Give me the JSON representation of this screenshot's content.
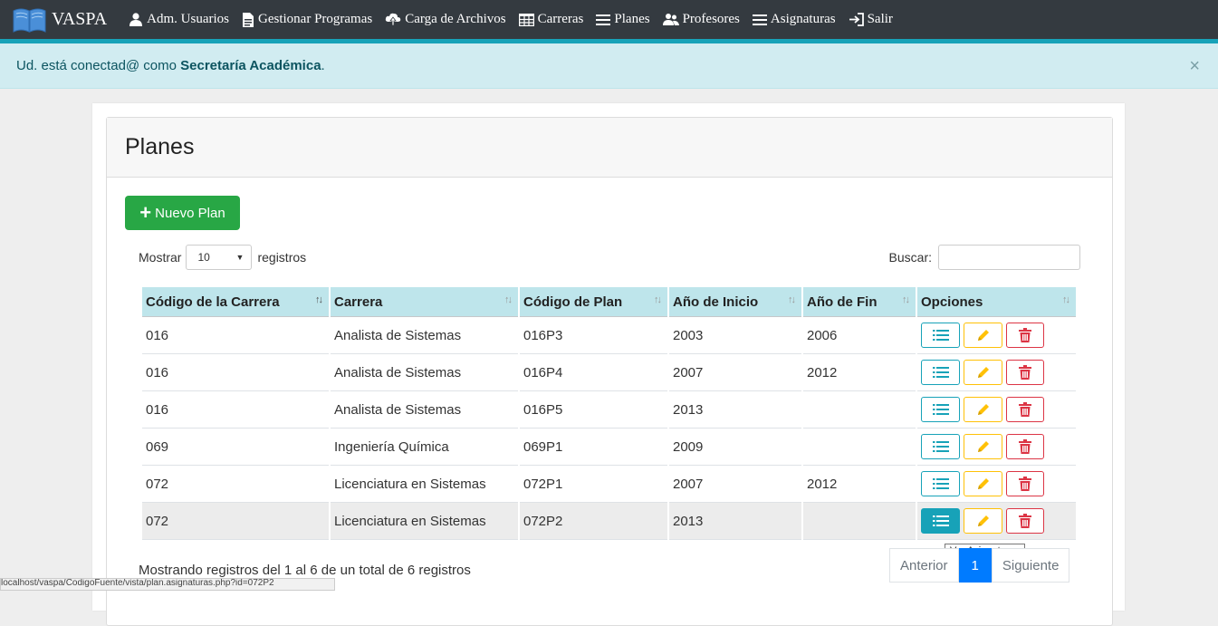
{
  "navbar": {
    "brand": "VASPA",
    "items": [
      {
        "label": "Adm. Usuarios",
        "icon": "user-icon"
      },
      {
        "label": "Gestionar Programas",
        "icon": "file-icon"
      },
      {
        "label": "Carga de Archivos",
        "icon": "cloud-upload-icon"
      },
      {
        "label": "Carreras",
        "icon": "table-icon"
      },
      {
        "label": "Planes",
        "icon": "list-icon"
      },
      {
        "label": "Profesores",
        "icon": "users-icon"
      },
      {
        "label": "Asignaturas",
        "icon": "list-icon"
      },
      {
        "label": "Salir",
        "icon": "sign-out-icon"
      }
    ]
  },
  "alert": {
    "prefix": "Ud. está conectad@ como ",
    "role": "Secretaría Académica",
    "suffix": ".",
    "close": "×"
  },
  "page": {
    "title": "Planes",
    "new_button": "Nuevo Plan",
    "show_label": "Mostrar",
    "show_value": "10",
    "records_label": "registros",
    "search_label": "Buscar:",
    "search_value": ""
  },
  "table": {
    "headers": [
      "Código de la Carrera",
      "Carrera",
      "Código de Plan",
      "Año de Inicio",
      "Año de Fin",
      "Opciones"
    ],
    "rows": [
      [
        "016",
        "Analista de Sistemas",
        "016P3",
        "2003",
        "2006"
      ],
      [
        "016",
        "Analista de Sistemas",
        "016P4",
        "2007",
        "2012"
      ],
      [
        "016",
        "Analista de Sistemas",
        "016P5",
        "2013",
        ""
      ],
      [
        "069",
        "Ingeniería Química",
        "069P1",
        "2009",
        ""
      ],
      [
        "072",
        "Licenciatura en Sistemas",
        "072P1",
        "2007",
        "2012"
      ],
      [
        "072",
        "Licenciatura en Sistemas",
        "072P2",
        "2013",
        ""
      ]
    ]
  },
  "tooltip": "Ver Asignaturas",
  "footer": {
    "info": "Mostrando registros del 1 al 6 de un total de 6 registros",
    "prev": "Anterior",
    "page": "1",
    "next": "Siguiente"
  },
  "statusbar": "localhost/vaspa/CodigoFuente/vista/plan.asignaturas.php?id=072P2",
  "colors": {
    "navbar": "#343a40",
    "accent": "#17a2b8",
    "success": "#28a745",
    "warning": "#ffc107",
    "danger": "#dc3545",
    "header_row": "#bee5eb",
    "alert_bg": "#d1ecf1",
    "page_active": "#007bff"
  }
}
